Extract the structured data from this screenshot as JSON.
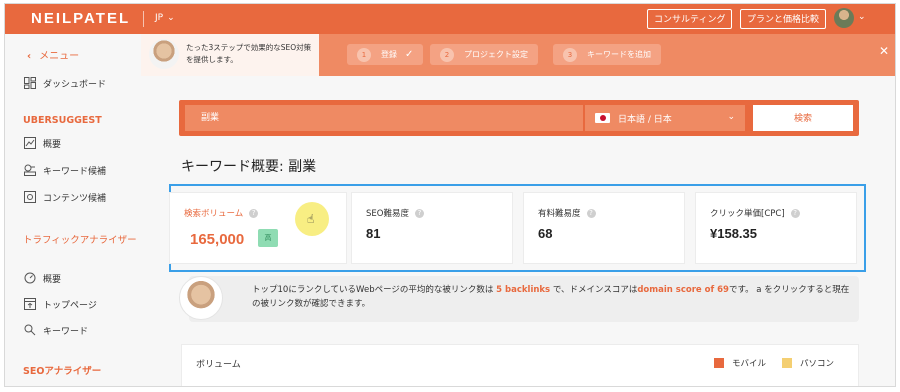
{
  "brand": {
    "accent": "#e8693e",
    "accent_light": "#ef8a63",
    "highlight": "#3a9fe8"
  },
  "topnav": {
    "logo": "NEILPATEL",
    "language": "JP",
    "consulting_label": "コンサルティング",
    "pricing_label": "プランと価格比較"
  },
  "sidebar": {
    "back_label": "メニュー",
    "dashboard": "ダッシュボード",
    "ubersuggest_heading": "UBERSUGGEST",
    "ubersuggest_items": [
      "概要",
      "キーワード候補",
      "コンテンツ候補"
    ],
    "traffic_heading": "トラフィックアナライザー",
    "traffic_items": [
      "概要",
      "トップページ",
      "キーワード"
    ],
    "seo_heading": "SEOアナライザー"
  },
  "onboarding": {
    "text": "たった3ステップで効果的なSEO対策を提供します。",
    "steps": [
      {
        "num": "1",
        "label": "登録"
      },
      {
        "num": "2",
        "label": "プロジェクト設定"
      },
      {
        "num": "3",
        "label": "キーワードを追加"
      }
    ]
  },
  "search": {
    "query": "副業",
    "locale": "日本語 / 日本",
    "button": "検索"
  },
  "overview": {
    "title": "キーワード概要: 副業",
    "metrics": [
      {
        "label": "検索ボリューム",
        "value": "165,000",
        "badge": "高"
      },
      {
        "label": "SEO難易度",
        "value": "81"
      },
      {
        "label": "有料難易度",
        "value": "68"
      },
      {
        "label": "クリック単価[CPC]",
        "value": "¥158.35"
      }
    ]
  },
  "backlink_note": {
    "part1": "トップ10にランクしているWebページの平均的な被リンク数は ",
    "backlinks": "5 backlinks",
    "part2": " で、ドメインスコアは",
    "domain_score": "domain score of 69",
    "part3": "です。 a をクリックすると現在の被リンク数が確認できます。"
  },
  "volume": {
    "title": "ボリューム",
    "legend": [
      {
        "label": "モバイル",
        "color": "#e8693e"
      },
      {
        "label": "パソコン",
        "color": "#f4cf72"
      }
    ]
  }
}
